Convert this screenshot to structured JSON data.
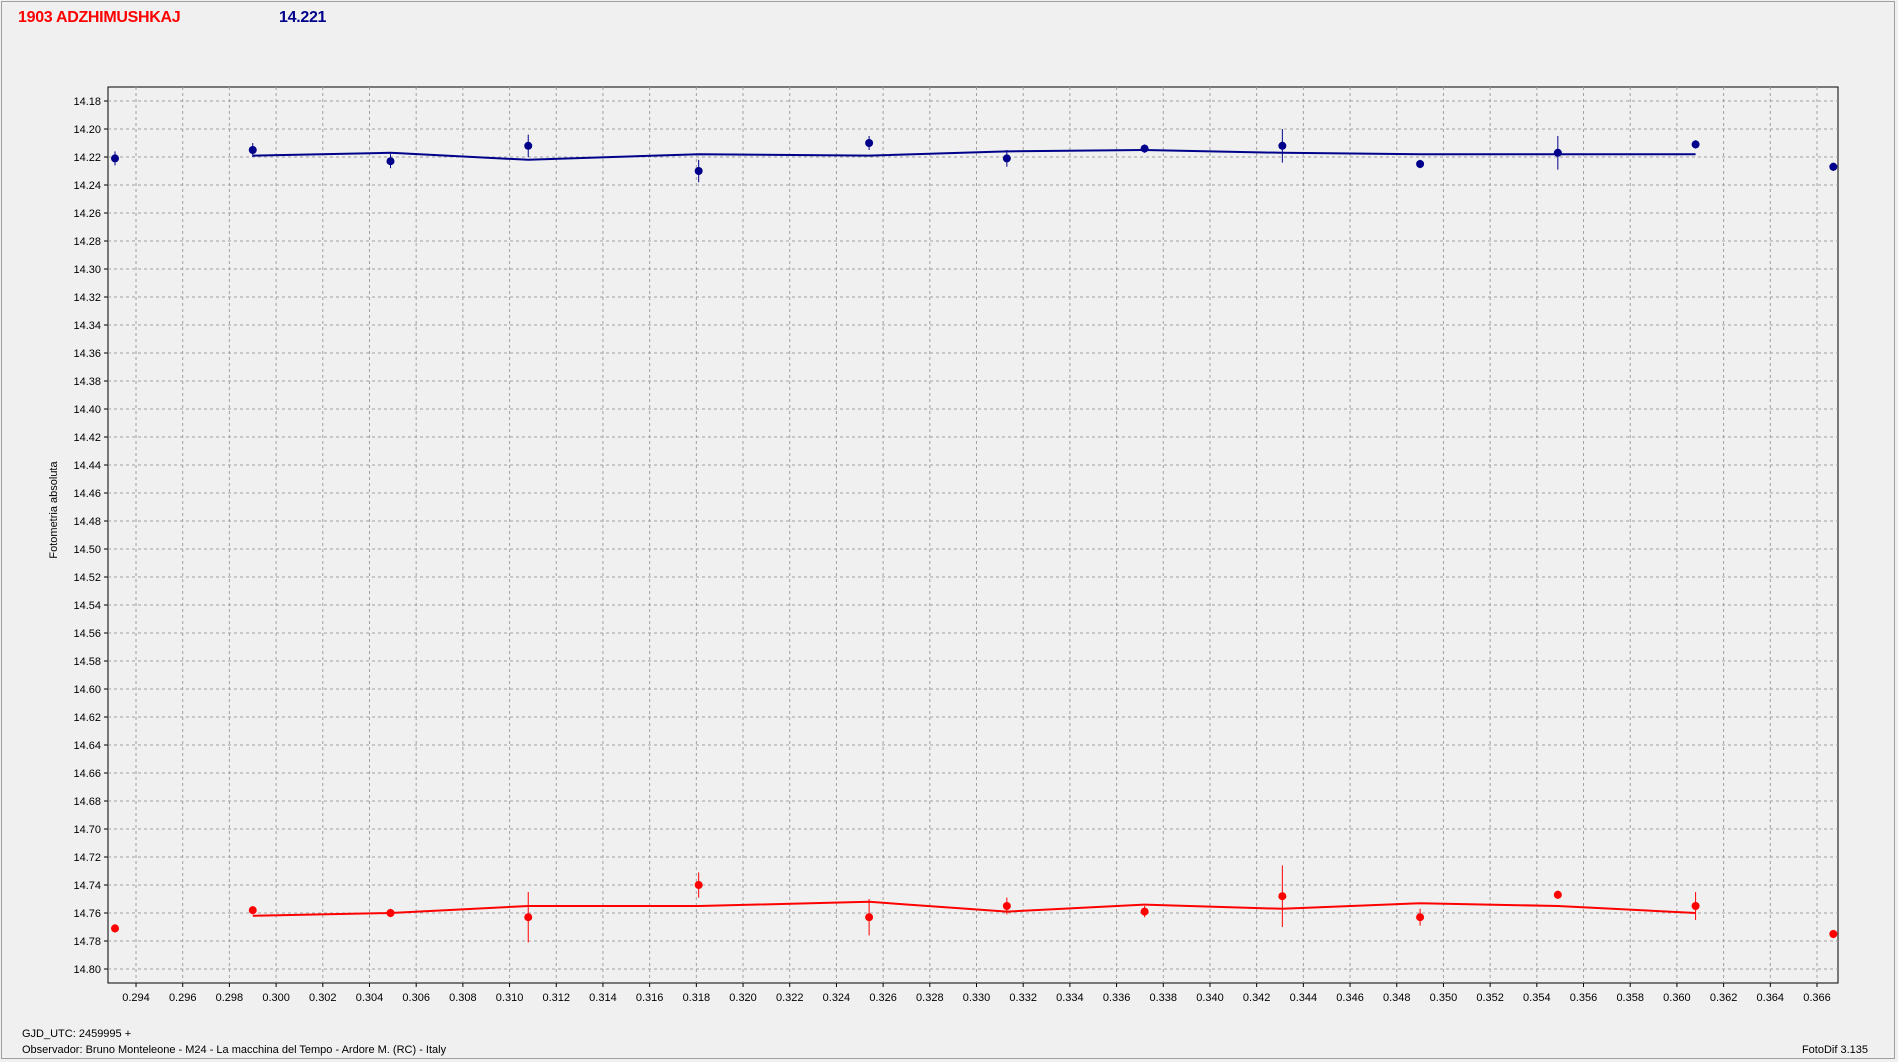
{
  "header": {
    "object_name": "1903 ADZHIMUSHKAJ",
    "magnitude": "14.221",
    "name_color": "#ff0000",
    "value_color": "#00008b"
  },
  "footer": {
    "gjd": "GJD_UTC: 2459995 +",
    "observer": "Observador: Bruno Monteleone - M24 - La macchina del Tempo - Ardore M. (RC) - Italy",
    "software": "FotoDif 3.135"
  },
  "chart_data": {
    "type": "scatter",
    "ylabel": "Fotometria absoluta",
    "xlabel": "",
    "xlim": [
      0.2928,
      0.3669
    ],
    "ylim": [
      14.17,
      14.81
    ],
    "y_inverted": true,
    "grid": true,
    "x_ticks": [
      "0.294",
      "0.296",
      "0.298",
      "0.300",
      "0.302",
      "0.304",
      "0.306",
      "0.308",
      "0.310",
      "0.312",
      "0.314",
      "0.316",
      "0.318",
      "0.320",
      "0.322",
      "0.324",
      "0.326",
      "0.328",
      "0.330",
      "0.332",
      "0.334",
      "0.336",
      "0.338",
      "0.340",
      "0.342",
      "0.344",
      "0.346",
      "0.348",
      "0.350",
      "0.352",
      "0.354",
      "0.356",
      "0.358",
      "0.360",
      "0.362",
      "0.364",
      "0.366"
    ],
    "y_ticks": [
      "14.18",
      "14.20",
      "14.22",
      "14.24",
      "14.26",
      "14.28",
      "14.30",
      "14.32",
      "14.34",
      "14.36",
      "14.38",
      "14.40",
      "14.42",
      "14.44",
      "14.46",
      "14.48",
      "14.50",
      "14.52",
      "14.54",
      "14.56",
      "14.58",
      "14.60",
      "14.62",
      "14.64",
      "14.66",
      "14.68",
      "14.70",
      "14.72",
      "14.74",
      "14.76",
      "14.78",
      "14.80"
    ],
    "series": [
      {
        "color": "#00008b",
        "points": [
          {
            "x": 0.2931,
            "y": 14.221,
            "err": 0.005
          },
          {
            "x": 0.299,
            "y": 14.215,
            "err": 0.005
          },
          {
            "x": 0.3049,
            "y": 14.223,
            "err": 0.005
          },
          {
            "x": 0.3108,
            "y": 14.212,
            "err": 0.008
          },
          {
            "x": 0.3181,
            "y": 14.23,
            "err": 0.008
          },
          {
            "x": 0.3254,
            "y": 14.21,
            "err": 0.005
          },
          {
            "x": 0.3313,
            "y": 14.221,
            "err": 0.006
          },
          {
            "x": 0.3372,
            "y": 14.214,
            "err": 0.003
          },
          {
            "x": 0.3431,
            "y": 14.212,
            "err": 0.012
          },
          {
            "x": 0.349,
            "y": 14.225,
            "err": 0.003
          },
          {
            "x": 0.3549,
            "y": 14.217,
            "err": 0.012
          },
          {
            "x": 0.3608,
            "y": 14.211,
            "err": 0.003
          },
          {
            "x": 0.3667,
            "y": 14.227,
            "err": 0.003
          }
        ],
        "fit": [
          {
            "x": 0.299,
            "y": 14.219
          },
          {
            "x": 0.3049,
            "y": 14.217
          },
          {
            "x": 0.3108,
            "y": 14.222
          },
          {
            "x": 0.3181,
            "y": 14.218
          },
          {
            "x": 0.3254,
            "y": 14.219
          },
          {
            "x": 0.3313,
            "y": 14.216
          },
          {
            "x": 0.3372,
            "y": 14.215
          },
          {
            "x": 0.3431,
            "y": 14.217
          },
          {
            "x": 0.349,
            "y": 14.218
          },
          {
            "x": 0.3549,
            "y": 14.218
          },
          {
            "x": 0.3608,
            "y": 14.218
          }
        ]
      },
      {
        "color": "#ff0000",
        "points": [
          {
            "x": 0.2931,
            "y": 14.771,
            "err": 0.003
          },
          {
            "x": 0.299,
            "y": 14.758,
            "err": 0.003
          },
          {
            "x": 0.3049,
            "y": 14.76,
            "err": 0.003
          },
          {
            "x": 0.3108,
            "y": 14.763,
            "err": 0.018
          },
          {
            "x": 0.3181,
            "y": 14.74,
            "err": 0.009
          },
          {
            "x": 0.3254,
            "y": 14.763,
            "err": 0.013
          },
          {
            "x": 0.3313,
            "y": 14.755,
            "err": 0.006
          },
          {
            "x": 0.3372,
            "y": 14.759,
            "err": 0.004
          },
          {
            "x": 0.3431,
            "y": 14.748,
            "err": 0.022
          },
          {
            "x": 0.349,
            "y": 14.763,
            "err": 0.006
          },
          {
            "x": 0.3549,
            "y": 14.747,
            "err": 0.003
          },
          {
            "x": 0.3608,
            "y": 14.755,
            "err": 0.01
          },
          {
            "x": 0.3667,
            "y": 14.775,
            "err": 0.003
          }
        ],
        "fit": [
          {
            "x": 0.299,
            "y": 14.762
          },
          {
            "x": 0.3049,
            "y": 14.76
          },
          {
            "x": 0.3108,
            "y": 14.755
          },
          {
            "x": 0.3181,
            "y": 14.755
          },
          {
            "x": 0.3254,
            "y": 14.752
          },
          {
            "x": 0.3313,
            "y": 14.759
          },
          {
            "x": 0.3372,
            "y": 14.754
          },
          {
            "x": 0.3431,
            "y": 14.757
          },
          {
            "x": 0.349,
            "y": 14.753
          },
          {
            "x": 0.3549,
            "y": 14.755
          },
          {
            "x": 0.3608,
            "y": 14.76
          }
        ]
      }
    ]
  }
}
